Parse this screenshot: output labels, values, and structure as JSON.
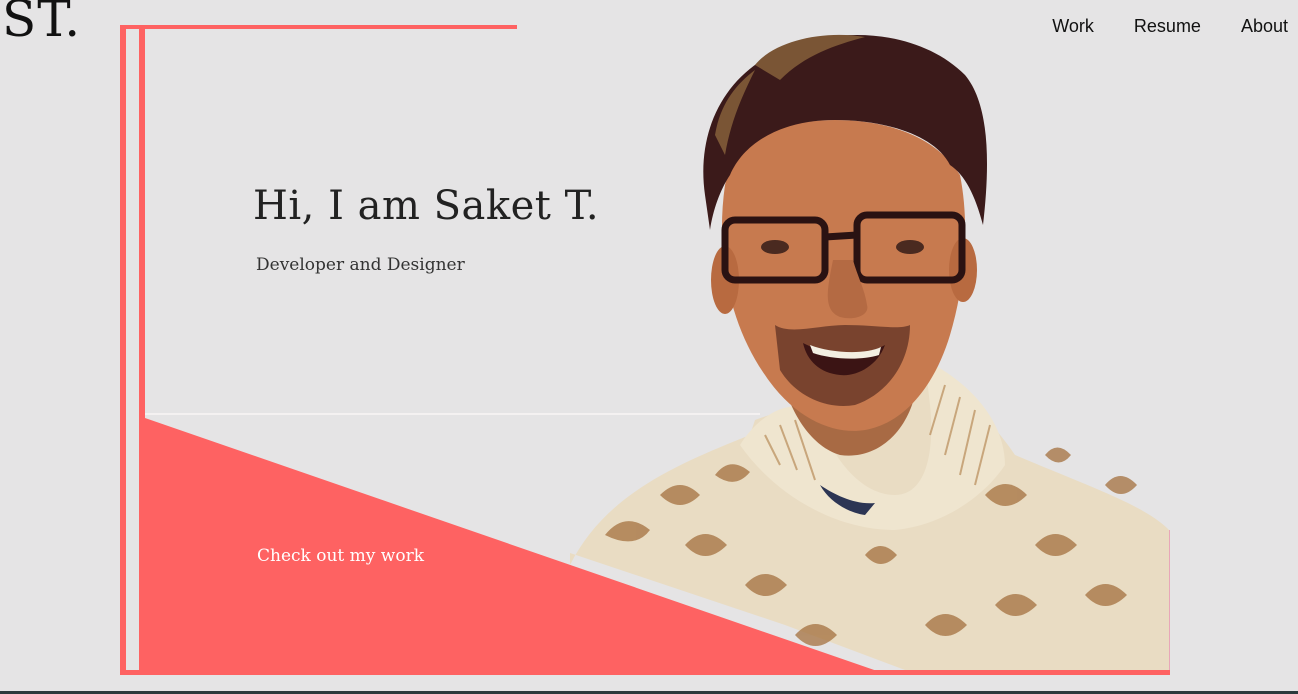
{
  "brand": {
    "logo_text": "ST."
  },
  "nav": {
    "items": [
      {
        "label": "Work"
      },
      {
        "label": "Resume"
      },
      {
        "label": "About"
      }
    ]
  },
  "hero": {
    "headline": "Hi, I am Saket T.",
    "subtitle": "Developer and Designer",
    "cta_label": "Check out my work",
    "portrait_icon": "person-photo-icon"
  },
  "colors": {
    "background": "#e5e4e5",
    "accent": "#fe6262",
    "text": "#222222",
    "sweater": "#e9dcc3",
    "sweater_shadow": "#a4713f",
    "skin": "#c77a4f",
    "hair": "#3b1a1a"
  }
}
